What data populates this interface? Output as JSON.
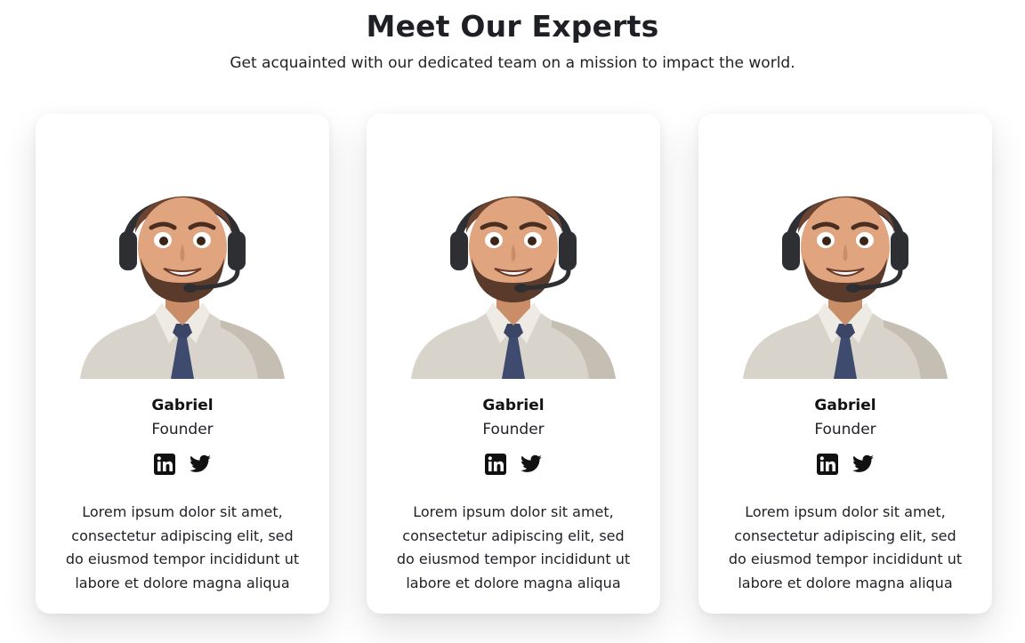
{
  "header": {
    "title": "Meet Our Experts",
    "subtitle": "Get acquainted with our dedicated team on a mission to impact the world."
  },
  "team": [
    {
      "name": "Gabriel",
      "role": "Founder",
      "avatar_icon": "support-agent-avatar",
      "socials": [
        "linkedin-icon",
        "twitter-icon"
      ],
      "bio": "Lorem ipsum dolor sit amet, consectetur adipiscing elit, sed do eiusmod tempor incididunt ut labore et dolore magna aliqua"
    },
    {
      "name": "Gabriel",
      "role": "Founder",
      "avatar_icon": "support-agent-avatar",
      "socials": [
        "linkedin-icon",
        "twitter-icon"
      ],
      "bio": "Lorem ipsum dolor sit amet, consectetur adipiscing elit, sed do eiusmod tempor incididunt ut labore et dolore magna aliqua"
    },
    {
      "name": "Gabriel",
      "role": "Founder",
      "avatar_icon": "support-agent-avatar",
      "socials": [
        "linkedin-icon",
        "twitter-icon"
      ],
      "bio": "Lorem ipsum dolor sit amet, consectetur adipiscing elit, sed do eiusmod tempor incididunt ut labore et dolore magna aliqua"
    }
  ],
  "colors": {
    "text": "#1e2026",
    "card_background": "#ffffff",
    "icon": "#111111"
  }
}
